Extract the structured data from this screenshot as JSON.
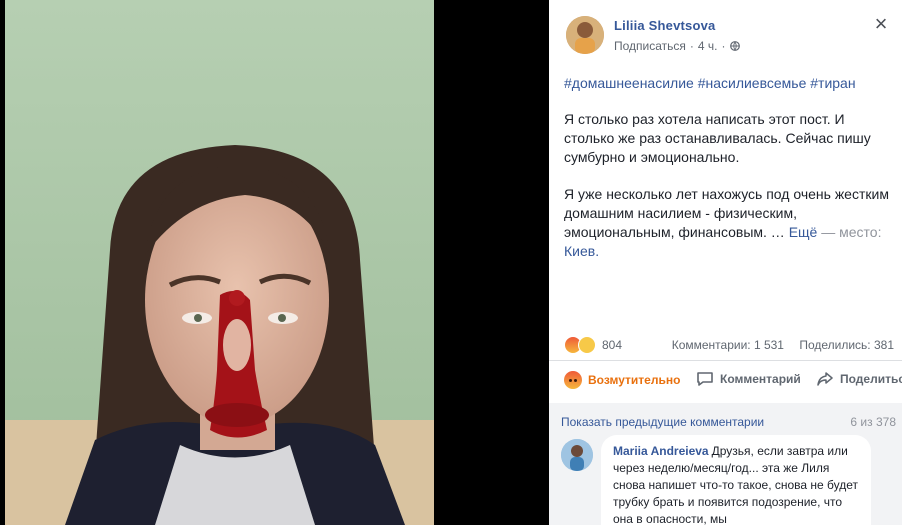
{
  "post": {
    "author": "Liliia Shevtsova",
    "follow_label": "Подписаться",
    "time": "4 ч.",
    "hashtags": "#домашнеенасилие #насилиевсемье #тиран",
    "paragraph1": "Я столько раз хотела написать этот пост. И столько же раз останавливалась. Сейчас пишу сумбурно и эмоционально.",
    "paragraph2": "Я уже несколько лет нахожусь под очень жестким домашним насилием - физическим, эмоциональным, финансовым. …",
    "more_label": "Ещё",
    "location_prefix": "— место:",
    "location": "Киев."
  },
  "stats": {
    "reaction_count": "804",
    "comments": "Комментарии: 1 531",
    "shares": "Поделились: 381"
  },
  "actions": {
    "angry": "Возмутительно",
    "comment": "Комментарий",
    "share": "Поделиться"
  },
  "comments": {
    "show_previous": "Показать предыдущие комментарии",
    "count_of": "6 из 378",
    "first": {
      "author": "Mariia Andreieva",
      "text": "Друзья, если завтра или через неделю/месяц/год... эта же Лиля снова напишет что-то такое, снова не будет трубку брать и появится подозрение, что она в опасности, мы"
    }
  },
  "icons": {
    "close": "close-icon",
    "globe": "globe-icon",
    "comment": "comment-icon",
    "share": "share-icon"
  },
  "colors": {
    "link": "#365899",
    "angry": "#e9710f",
    "wall": "#a9c7a6"
  }
}
